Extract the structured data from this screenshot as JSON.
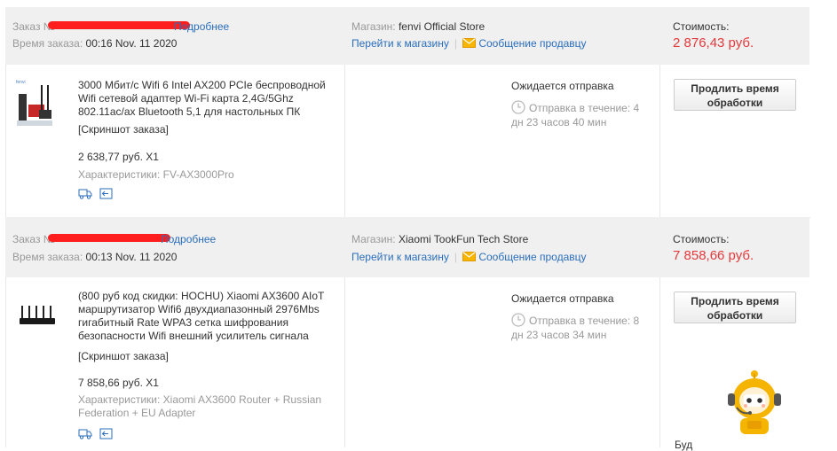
{
  "orders": [
    {
      "order_label": "Заказ №",
      "details_link": "Подробнее",
      "time_label": "Время заказа:",
      "time_value": "00:16 Nov. 11 2020",
      "store_label": "Магазин:",
      "store_name": "fenvi Official Store",
      "goto_store": "Перейти к магазину",
      "message_seller": "Сообщение продавцу",
      "cost_label": "Стоимость:",
      "cost_value": "2 876,43 руб.",
      "product_title": "3000 Мбит/с Wifi 6 Intel AX200 PCIe беспроводной Wifi сетевой адаптер Wi-Fi карта 2,4G/5Ghz 802.11ac/ax Bluetooth 5,1 для настольных ПК",
      "snapshot": "[Скриншот заказа]",
      "price_qty": "2 638,77 руб. X1",
      "specs": "Характеристики: FV-AX3000Pro",
      "status": "Ожидается отправка",
      "shipping_line1": "Отправка в течение: 4",
      "shipping_line2": "дн 23 часов 40 мин",
      "extend_button": "Продлить время обработки"
    },
    {
      "order_label": "Заказ №",
      "details_link": "Подробнее",
      "time_label": "Время заказа:",
      "time_value": "00:13 Nov. 11 2020",
      "store_label": "Магазин:",
      "store_name": "Xiaomi TookFun Tech Store",
      "goto_store": "Перейти к магазину",
      "message_seller": "Сообщение продавцу",
      "cost_label": "Стоимость:",
      "cost_value": "7 858,66 руб.",
      "product_title": "(800 руб код скидки: HOCHU) Xiaomi AX3600 AIoT маршрутизатор Wifi6 двухдиапазонный 2976Mbs гигабитный Rate WPA3 сетка шифрования безопасности Wifi внешний усилитель сигнала",
      "snapshot": "[Скриншот заказа]",
      "price_qty": "7 858,66 руб. X1",
      "specs": "Характеристики: Xiaomi AX3600 Router + Russian Federation + EU Adapter",
      "status": "Ожидается отправка",
      "shipping_line1": "Отправка в течение: 8",
      "shipping_line2": "дн 23 часов 34 мин",
      "extend_button": "Продлить время обработки"
    }
  ],
  "assistant_text": "Буд",
  "colors": {
    "price": "#e4393c",
    "link": "#2a6ebb",
    "header_bg": "#f0f0f0",
    "redaction": "#ff1e1e"
  }
}
